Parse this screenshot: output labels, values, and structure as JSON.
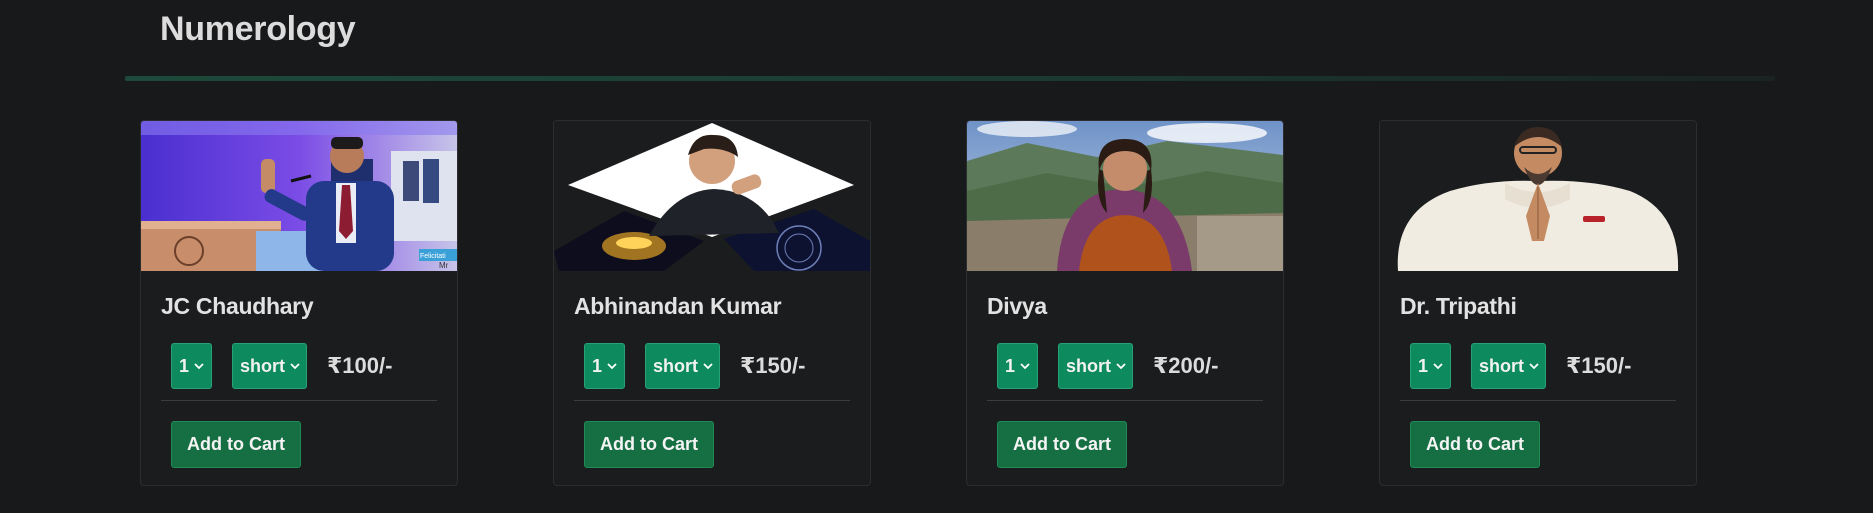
{
  "section": {
    "title": "Numerology"
  },
  "cards": [
    {
      "name": "JC Chaudhary",
      "quantity": "1",
      "duration": "short",
      "price": "₹100/-",
      "cart_label": "Add to Cart",
      "photo_caption": "Felicitati",
      "photo_caption2": "Mr"
    },
    {
      "name": "Abhinandan Kumar",
      "quantity": "1",
      "duration": "short",
      "price": "₹150/-",
      "cart_label": "Add to Cart"
    },
    {
      "name": "Divya",
      "quantity": "1",
      "duration": "short",
      "price": "₹200/-",
      "cart_label": "Add to Cart"
    },
    {
      "name": "Dr. Tripathi",
      "quantity": "1",
      "duration": "short",
      "price": "₹150/-",
      "cart_label": "Add to Cart"
    }
  ],
  "colors": {
    "background": "#18191b",
    "card": "#1b1c1e",
    "select": "#0e8a5f",
    "button": "#156f42",
    "divider": "#1d4a3a"
  },
  "icons": {
    "select_arrow": "chevron-down-icon"
  }
}
